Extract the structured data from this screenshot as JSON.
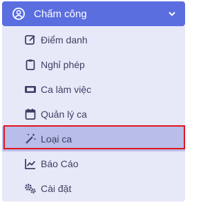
{
  "header": {
    "label": "Chấm công",
    "icon": "user-circle-icon",
    "chevron": "chevron-down-icon"
  },
  "items": [
    {
      "label": "Điểm danh",
      "icon": "edit-icon"
    },
    {
      "label": "Nghỉ phép",
      "icon": "clipboard-icon"
    },
    {
      "label": "Ca làm việc",
      "icon": "ticket-icon"
    },
    {
      "label": "Quản lý ca",
      "icon": "calendar-icon"
    },
    {
      "label": "Loại ca",
      "icon": "magic-wand-icon"
    },
    {
      "label": "Báo Cáo",
      "icon": "chart-line-icon"
    },
    {
      "label": "Cài đặt",
      "icon": "gears-icon"
    }
  ],
  "selected_item": "Loại ca",
  "colors": {
    "header_bg": "#5b6ee0",
    "submenu_bg": "#e8e9f8",
    "active_bg": "#b9bde9",
    "text": "#3c3f63",
    "highlight_border": "#e0141b"
  }
}
